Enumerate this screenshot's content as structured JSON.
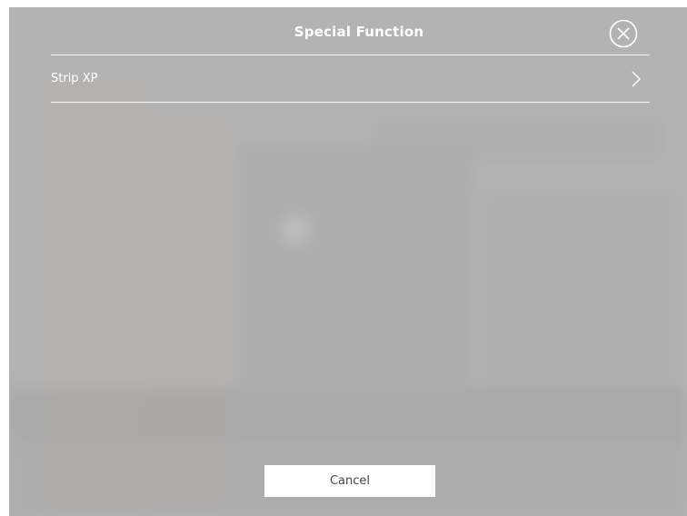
{
  "dialog": {
    "title": "Special Function",
    "close_icon": "close-circle-icon",
    "items": [
      {
        "label": "Strip XP",
        "icon": "chevron-right-icon"
      }
    ],
    "cancel_label": "Cancel"
  },
  "colors": {
    "overlay": "#b3b3b3",
    "text": "#ffffff",
    "divider": "#ffffff",
    "button_bg": "#ffffff",
    "button_text": "#444444"
  }
}
